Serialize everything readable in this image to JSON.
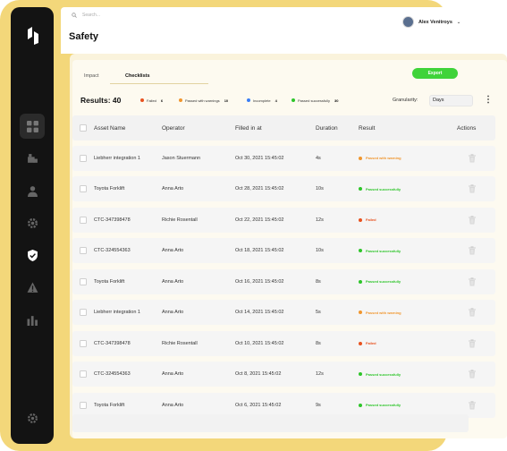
{
  "search": {
    "placeholder": "Search..."
  },
  "user": {
    "name": "Alex Venitroys"
  },
  "page": {
    "title": "Safety"
  },
  "tabs": [
    {
      "label": "Impact"
    },
    {
      "label": "Checklists"
    }
  ],
  "export_label": "Export",
  "results": {
    "label": "Results: 40",
    "legend": [
      {
        "label": "Failed",
        "count": "6",
        "color": "#e8521f"
      },
      {
        "label": "Passed with warnings",
        "count": "10",
        "color": "#f0962e"
      },
      {
        "label": "Incomplete",
        "count": "4",
        "color": "#3b7ef5"
      },
      {
        "label": "Passed successfully",
        "count": "30",
        "color": "#2ec52a"
      }
    ]
  },
  "granularity": {
    "label": "Granularity:",
    "value": "Days"
  },
  "table": {
    "headers": {
      "asset": "Asset Name",
      "operator": "Operator",
      "filled": "Filled in at",
      "duration": "Duration",
      "result": "Result",
      "actions": "Actions"
    },
    "rows": [
      {
        "asset": "Liebherr integration 1",
        "operator": "Jason Stuermann",
        "filled": "Oct 30, 2021 15:45:02",
        "duration": "4s",
        "result": "Passed with warning",
        "color": "#f0962e"
      },
      {
        "asset": "Toyota Forklift",
        "operator": "Anna Arto",
        "filled": "Oct 28, 2021 15:45:02",
        "duration": "10s",
        "result": "Passed successfully",
        "color": "#2ec52a"
      },
      {
        "asset": "CTC-347398478",
        "operator": "Richie Rosentall",
        "filled": "Oct 22, 2021 15:45:02",
        "duration": "12s",
        "result": "Failed",
        "color": "#e8521f"
      },
      {
        "asset": "CTC-324554363",
        "operator": "Anna Arto",
        "filled": "Oct 18, 2021 15:45:02",
        "duration": "10s",
        "result": "Passed successfully",
        "color": "#2ec52a"
      },
      {
        "asset": "Toyota Forklift",
        "operator": "Anna Arto",
        "filled": "Oct 16, 2021 15:45:02",
        "duration": "8s",
        "result": "Passed successfully",
        "color": "#2ec52a"
      },
      {
        "asset": "Liebherr integration 1",
        "operator": "Anna Arto",
        "filled": "Oct 14, 2021 15:45:02",
        "duration": "5s",
        "result": "Passed with warning",
        "color": "#f0962e"
      },
      {
        "asset": "CTC-347398478",
        "operator": "Richie Rosentall",
        "filled": "Oct 10, 2021 15:45:02",
        "duration": "8s",
        "result": "Failed",
        "color": "#e8521f"
      },
      {
        "asset": "CTC-324554363",
        "operator": "Anna Arto",
        "filled": "Oct 8, 2021 15:45:02",
        "duration": "12s",
        "result": "Passed successfully",
        "color": "#2ec52a"
      },
      {
        "asset": "Toyota Forklift",
        "operator": "Anna Arto",
        "filled": "Oct 6, 2021 15:45:02",
        "duration": "9s",
        "result": "Passed successfully",
        "color": "#2ec52a"
      }
    ]
  },
  "icons": {
    "nav": [
      "dashboard-icon",
      "vehicle-icon",
      "user-icon",
      "settings-cog-icon",
      "safety-shield-icon",
      "warning-icon",
      "analytics-icon"
    ],
    "bottom": "settings-icon",
    "row_action": "trash-icon"
  },
  "colors": {
    "accent_green": "#3fd33a",
    "frame_yellow": "#f3d77a",
    "sidebar_dark": "#131313"
  }
}
